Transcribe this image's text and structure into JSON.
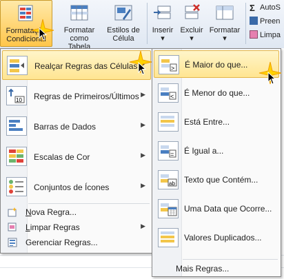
{
  "ribbon": {
    "conditional_formatting": {
      "line1": "Formatação",
      "line2": "Condicional"
    },
    "format_as_table": {
      "line1": "Formatar",
      "line2": "como Tabela"
    },
    "cell_styles": {
      "line1": "Estilos de",
      "line2": "Célula"
    },
    "insert": {
      "label": "Inserir"
    },
    "delete": {
      "label": "Excluir"
    },
    "format": {
      "label": "Formatar"
    },
    "autosum": {
      "label": "AutoS"
    },
    "fill": {
      "label": "Preen"
    },
    "clear": {
      "label": "Limpa"
    }
  },
  "menu_conditional": {
    "items": [
      {
        "label": "Realçar Regras das Células",
        "icon": "highlight-cells-rules-icon",
        "submenu": true,
        "highlighted": true
      },
      {
        "label": "Regras de Primeiros/Últimos",
        "icon": "top-bottom-rules-icon",
        "submenu": true
      },
      {
        "label": "Barras de Dados",
        "icon": "data-bars-icon",
        "submenu": true
      },
      {
        "label": "Escalas de Cor",
        "icon": "color-scales-icon",
        "submenu": true
      },
      {
        "label": "Conjuntos de Ícones",
        "icon": "icon-sets-icon",
        "submenu": true
      }
    ],
    "small_items": [
      {
        "label": "Nova Regra...",
        "icon": "new-rule-icon"
      },
      {
        "label": "Limpar Regras",
        "icon": "clear-rules-icon",
        "submenu": true
      },
      {
        "label": "Gerenciar Regras...",
        "icon": "manage-rules-icon"
      }
    ]
  },
  "menu_highlight_rules": {
    "items": [
      {
        "label": "É Maior do que...",
        "icon": "greater-than-icon",
        "highlighted": true
      },
      {
        "label": "É Menor do que...",
        "icon": "less-than-icon"
      },
      {
        "label": "Está Entre...",
        "icon": "between-icon"
      },
      {
        "label": "É Igual a...",
        "icon": "equal-to-icon"
      },
      {
        "label": "Texto que Contém...",
        "icon": "text-contains-icon"
      },
      {
        "label": "Uma Data que Ocorre...",
        "icon": "date-occurring-icon"
      },
      {
        "label": "Valores Duplicados...",
        "icon": "duplicate-values-icon"
      }
    ],
    "more_rules": "Mais Regras..."
  },
  "colors": {
    "highlight": "#ffe592",
    "menu_border": "#868686",
    "ribbon_bg": "#dfe7f2"
  }
}
